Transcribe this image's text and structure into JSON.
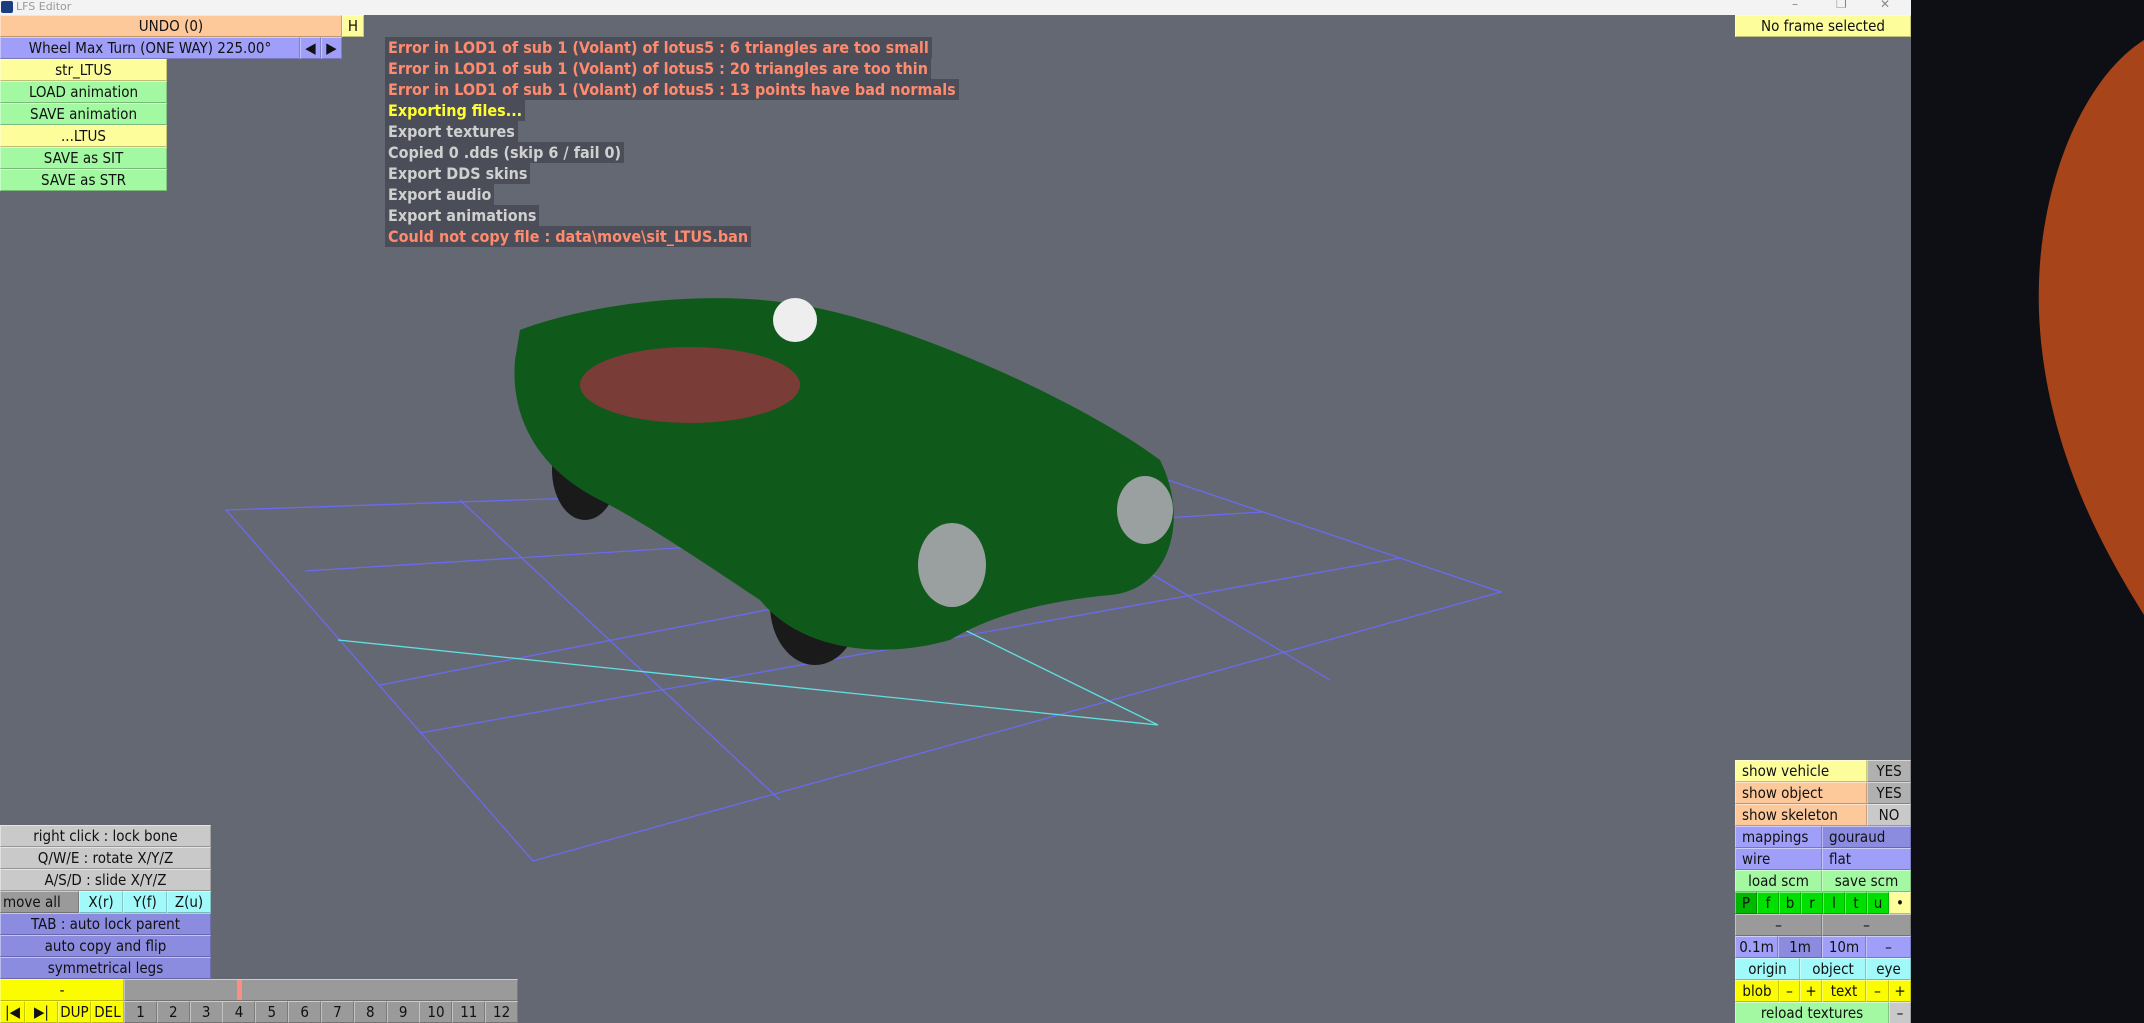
{
  "window": {
    "title": "LFS Editor",
    "controls": [
      "–",
      "❐",
      "✕"
    ]
  },
  "top_left": {
    "undo": "UNDO (0)",
    "help": "H",
    "wheel": "Wheel Max Turn (ONE WAY) 225.00°",
    "prev": "◀",
    "next": "▶",
    "buttons": [
      {
        "label": "str_LTUS",
        "color": "yellow"
      },
      {
        "label": "LOAD animation",
        "color": "green"
      },
      {
        "label": "SAVE animation",
        "color": "green"
      },
      {
        "label": "...LTUS",
        "color": "yellow"
      },
      {
        "label": "SAVE as SIT",
        "color": "green"
      },
      {
        "label": "SAVE as STR",
        "color": "green"
      }
    ]
  },
  "log": [
    {
      "text": "Error in LOD1 of sub 1 (Volant) of lotus5 : 6 triangles are too small",
      "type": "err"
    },
    {
      "text": "Error in LOD1 of sub 1 (Volant) of lotus5 : 20 triangles are too thin",
      "type": "err"
    },
    {
      "text": "Error in LOD1 of sub 1 (Volant) of lotus5 : 13 points have bad normals",
      "type": "err"
    },
    {
      "text": "Exporting files...",
      "type": "warn"
    },
    {
      "text": "Export textures",
      "type": "info"
    },
    {
      "text": "Copied 0 .dds (skip 6 / fail 0)",
      "type": "info"
    },
    {
      "text": "Export DDS skins",
      "type": "info"
    },
    {
      "text": "Export audio",
      "type": "info"
    },
    {
      "text": "Export animations",
      "type": "info"
    },
    {
      "text": "Could not copy file : data\\move\\sit_LTUS.ban",
      "type": "err"
    }
  ],
  "frame_status": "No frame selected",
  "bottom_left": {
    "hints": [
      "right click : lock bone",
      "Q/W/E : rotate X/Y/Z",
      "A/S/D : slide X/Y/Z"
    ],
    "move_all": "move all",
    "axes": [
      "X(r)",
      "Y(f)",
      "Z(u)"
    ],
    "options": [
      "TAB : auto lock parent",
      "auto copy and flip",
      "symmetrical legs"
    ],
    "frame_name": "-",
    "first": "|◀",
    "last": "▶|",
    "dup": "DUP",
    "del": "DEL"
  },
  "timeline": {
    "frames": [
      "1",
      "2",
      "3",
      "4",
      "5",
      "6",
      "7",
      "8",
      "9",
      "10",
      "11",
      "12"
    ],
    "position_frame": 5
  },
  "right_panel": {
    "show_vehicle": "show vehicle",
    "show_vehicle_val": "YES",
    "show_object": "show object",
    "show_object_val": "YES",
    "show_skeleton": "show skeleton",
    "show_skeleton_val": "NO",
    "mappings": "mappings",
    "gouraud": "gouraud",
    "wire": "wire",
    "flat": "flat",
    "load_scm": "load scm",
    "save_scm": "save scm",
    "views": [
      "P",
      "f",
      "b",
      "r",
      "l",
      "t",
      "u",
      "•"
    ],
    "minus1": "–",
    "minus2": "–",
    "grid": [
      "0.1m",
      "1m",
      "10m",
      "–"
    ],
    "centre": [
      "origin",
      "object",
      "eye"
    ],
    "blob": "blob",
    "blob_minus": "–",
    "blob_plus": "+",
    "text": "text",
    "text_minus": "–",
    "text_plus": "+",
    "reload": "reload textures",
    "reload_minus": "–"
  },
  "colors": {
    "viewport": "#646872",
    "grid": "#6a6af0",
    "axis": "#60e0e0",
    "car": "#0f5a1a"
  }
}
